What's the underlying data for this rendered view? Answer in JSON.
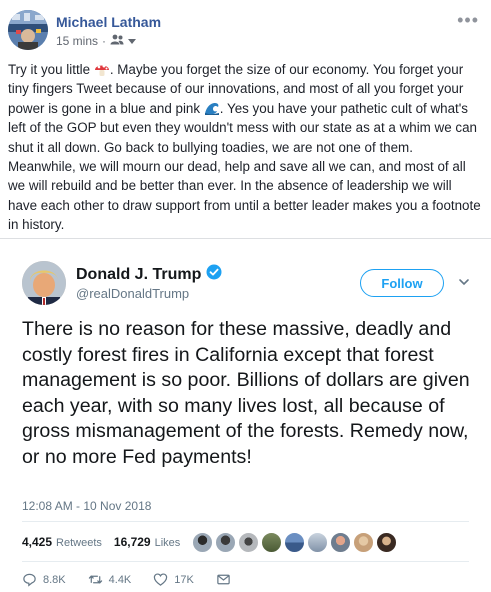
{
  "post": {
    "author": "Michael Latham",
    "time": "15 mins",
    "separator": "·",
    "audience_icon": "friends-icon",
    "text_segments": [
      "Try it you little ",
      ". Maybe you forget the size of our economy. You forget your tiny fingers Tweet because of our innovations, and most of all you forget your power is gone in a blue and pink ",
      ". Yes you have your pathetic cult of what's left of the GOP but even they wouldn't mess with our state as at a whim we can shut it all down. Go back to bullying toadies, we are not one of them. Meanwhile, we will mourn our dead, help and save all we can, and most of all we will rebuild and be better than ever. In the absence of leadership we will have each other to draw support from until a better leader makes you a footnote in history."
    ],
    "emoji": [
      "mushroom-icon",
      "wave-icon"
    ]
  },
  "tweet": {
    "name": "Donald J. Trump",
    "handle": "@realDonaldTrump",
    "follow_label": "Follow",
    "text": "There is no reason for these massive, deadly and costly forest fires in California except that forest management is so poor. Billions of dollars are given each year, with so many lives lost, all because of gross mismanagement of the forests. Remedy now, or no more Fed payments!",
    "timestamp": "12:08 AM - 10 Nov 2018",
    "retweets_count": "4,425",
    "retweets_label": "Retweets",
    "likes_count": "16,729",
    "likes_label": "Likes",
    "actions": {
      "replies": "8.8K",
      "retweets": "4.4K",
      "likes": "17K"
    }
  },
  "colors": {
    "fb_link": "#365899",
    "twitter_blue": "#1da1f2",
    "verified": "#1da1f2",
    "muted": "#657786"
  }
}
